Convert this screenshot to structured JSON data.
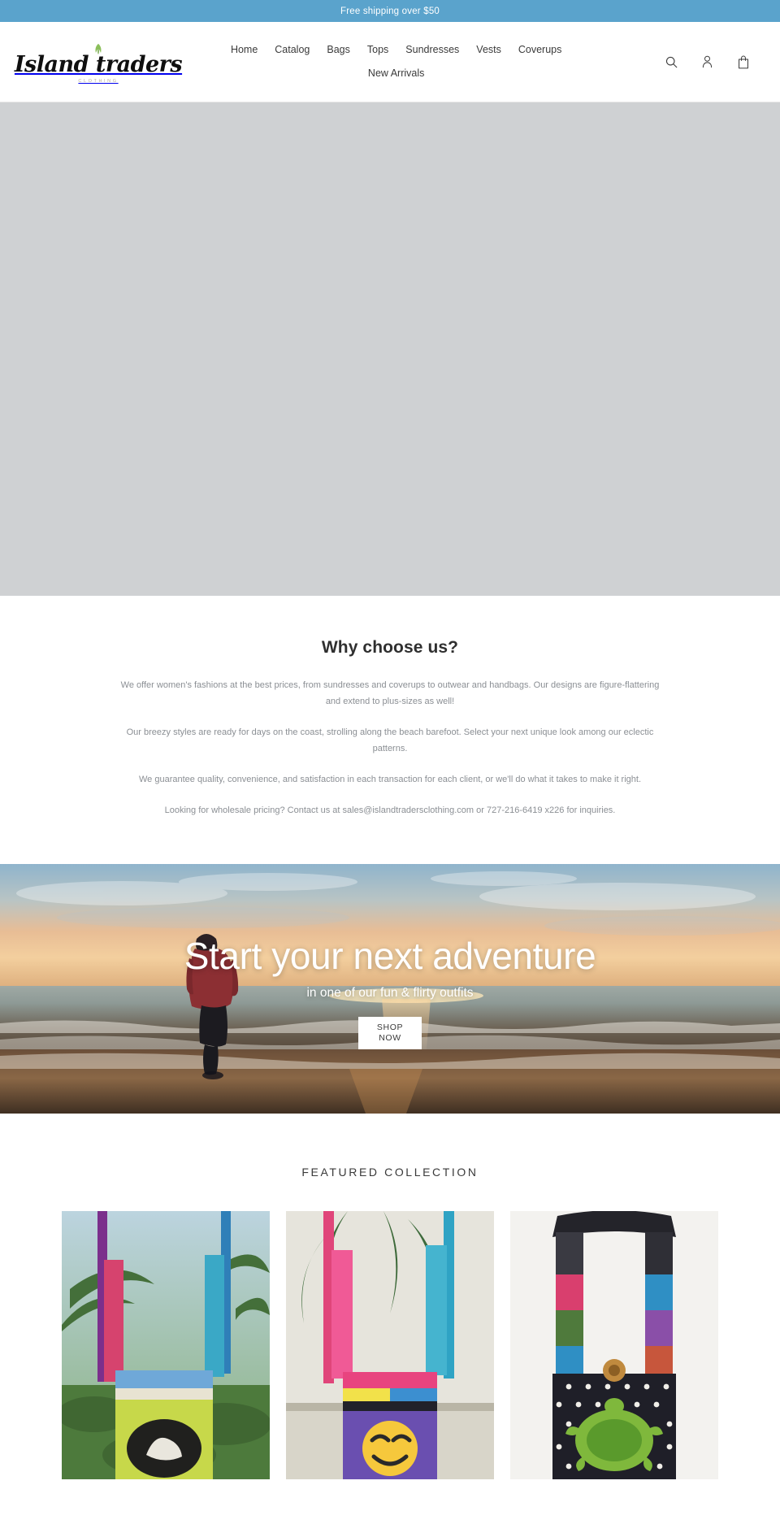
{
  "announcement": {
    "text": "Free shipping over $50"
  },
  "header": {
    "logo": {
      "wordmark": "Island traders",
      "subtitle": "CLOTHING",
      "leaf_icon": "leaf-icon"
    },
    "nav": [
      {
        "label": "Home"
      },
      {
        "label": "Catalog"
      },
      {
        "label": "Bags"
      },
      {
        "label": "Tops"
      },
      {
        "label": "Sundresses"
      },
      {
        "label": "Vests"
      },
      {
        "label": "Coverups"
      },
      {
        "label": "New Arrivals"
      }
    ],
    "icons": [
      {
        "name": "search-icon",
        "label": "Search"
      },
      {
        "name": "account-icon",
        "label": "Log in"
      },
      {
        "name": "cart-icon",
        "label": "Cart"
      }
    ]
  },
  "richtext": {
    "heading": "Why choose us?",
    "paragraphs": [
      "We offer women's fashions at the best prices, from sundresses and coverups to outwear and handbags. Our designs are figure-flattering and extend to plus-sizes as well!",
      "Our breezy styles are ready for days on the coast, strolling along the beach barefoot. Select your next unique look among our eclectic patterns.",
      "We guarantee quality, convenience, and satisfaction in each transaction for each client, or we'll do what it takes to make it right.",
      "Looking for wholesale pricing? Contact us at sales@islandtradersclothing.com or 727-216-6419 x226 for inquiries."
    ]
  },
  "banner": {
    "heading": "Start your next adventure",
    "subheading": "in one of our fun & flirty outfits",
    "button_label": "SHOP NOW",
    "button_line1": "SHOP",
    "button_line2": "NOW"
  },
  "featured": {
    "title": "FEATURED COLLECTION",
    "products": [
      {
        "name": "patchwork-sling-bag-green-elephant"
      },
      {
        "name": "patchwork-sling-bag-emoji"
      },
      {
        "name": "patchwork-sling-bag-turtle"
      }
    ]
  },
  "colors": {
    "announcement_bg": "#5aa3cc",
    "text": "#3a3a3a",
    "muted_text": "#8b8f94",
    "placeholder_gray": "#cfd1d3",
    "logo_sub": "#b9b093",
    "leaf_green": "#8bbf5a"
  }
}
